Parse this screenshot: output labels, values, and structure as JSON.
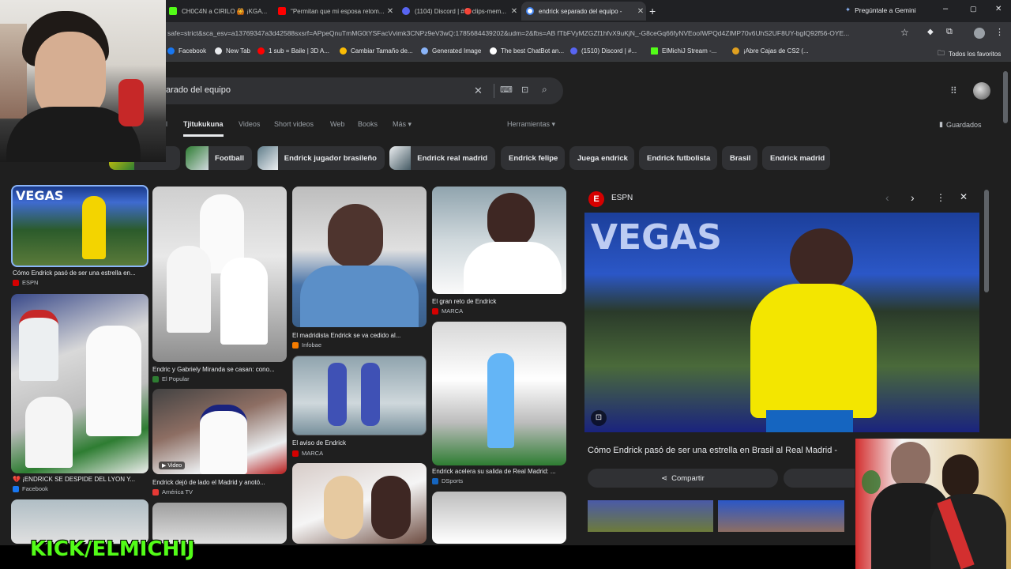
{
  "tabs": [
    {
      "label": "CH0C4N a CIRILO 🙆 ¡KGA...",
      "color": "#53fc18"
    },
    {
      "label": "\"Permitan que mi esposa retom...",
      "color": "#ff0000"
    },
    {
      "label": "(1104) Discord | #🔴clips-mem...",
      "color": "#5865f2"
    },
    {
      "label": "endrick separado del equipo - ",
      "color": "#4285f4"
    }
  ],
  "gemini_label": "Pregúntale a Gemini",
  "url": "safe=strict&sca_esv=a13769347a3d42588sxsrf=APpeQnuTmMG0tYSFacVvimk3CNPz9eV3wQ:1785684439202&udm=2&fbs=AB fTbFVyMZGZf1hfvX9uKjN_-G8ceGq66fyNVEooIWPQd4ZlMP70v6UhS2UF8UY-bgIQ92f56-OYE...",
  "bookmarks": [
    {
      "label": "Facebook",
      "color": "#1877f2"
    },
    {
      "label": "New Tab",
      "color": "#e8eaed"
    },
    {
      "label": "1 sub = Baile | 3D A...",
      "color": "#ff0000"
    },
    {
      "label": "Cambiar Tamaño de...",
      "color": "#fbbc05"
    },
    {
      "label": "Generated Image",
      "color": "#8ab4f8"
    },
    {
      "label": "The best ChatBot an...",
      "color": "#ffffff"
    },
    {
      "label": "(1510) Discord | #...",
      "color": "#5865f2"
    },
    {
      "label": "ElMichiJ Stream -...",
      "color": "#53fc18"
    },
    {
      "label": "¡Abre Cajas de CS2 (...",
      "color": "#e0a020"
    }
  ],
  "all_bookmarks": "Todos los favoritos",
  "search": {
    "query": "arado del equipo"
  },
  "tools": {
    "all": "ll",
    "active": "Tjitukukuna",
    "videos": "Videos",
    "short_videos": "Short videos",
    "web": "Web",
    "books": "Books",
    "more": "Más ▾",
    "tools": "Herramientas ▾",
    "saved": "Guardados"
  },
  "chips": [
    {
      "label": "egador"
    },
    {
      "label": "Football"
    },
    {
      "label": "Endrick jugador brasileño"
    },
    {
      "label": "Endrick real madrid"
    },
    {
      "label": "Endrick felipe"
    },
    {
      "label": "Juega endrick"
    },
    {
      "label": "Endrick futbolista"
    },
    {
      "label": "Brasil"
    },
    {
      "label": "Endrick madrid"
    }
  ],
  "results": [
    {
      "caption": "Cómo Endrick pasó de ser una estrella en...",
      "source": "ESPN",
      "src_color": "#d50000"
    },
    {
      "caption": "💔 ¡ENDRICK SE DESPIDE DEL LYON Y...",
      "source": "Facebook",
      "src_color": "#1877f2"
    },
    {
      "caption": "Endric y Gabriely Miranda se casan: cono...",
      "source": "El Popular",
      "src_color": "#2e7d32"
    },
    {
      "caption": "Endrick dejó de lado el Madrid y anotó...",
      "source": "América TV",
      "src_color": "#e53935"
    },
    {
      "caption": "El madridista Endrick se va cedido al...",
      "source": "Infobae",
      "src_color": "#f57c00"
    },
    {
      "caption": "El aviso de Endrick",
      "source": "MARCA",
      "src_color": "#d50000"
    },
    {
      "caption": "El gran reto de Endrick",
      "source": "MARCA",
      "src_color": "#d50000"
    },
    {
      "caption": "Endrick acelera su salida de Real Madrid: ...",
      "source": "DSports",
      "src_color": "#1565c0"
    }
  ],
  "video_badge": "▶ Video",
  "panel": {
    "source": "ESPN",
    "title": "Cómo Endrick pasó de ser una estrella en Brasil al Real Madrid -",
    "share": "Compartir"
  },
  "stream_label": "KICK/ELMICHIJ"
}
